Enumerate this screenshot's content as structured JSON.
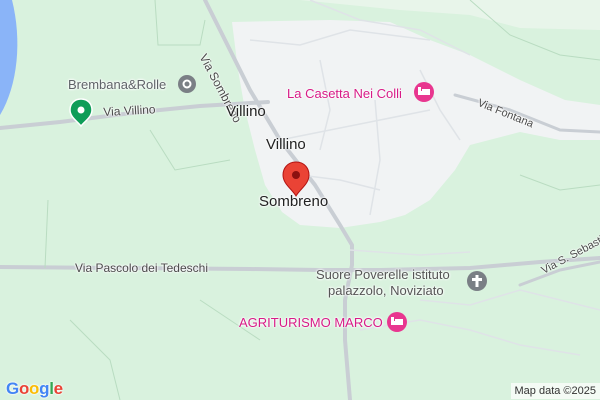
{
  "map": {
    "places": {
      "villino_top": "Villino",
      "villino_mid": "Villino",
      "sombreno": "Sombreno"
    },
    "roads": {
      "via_sombreno": "Via Sombreno",
      "via_villino": "Via Villino",
      "via_fontana": "Via Fontana",
      "via_pascolo": "Via Pascolo dei Tedeschi",
      "via_s_sebastiano": "Via S. Sebastiano"
    },
    "pois": {
      "brembana": "Brembana&Rolle",
      "casetta": "La Casetta Nei Colli",
      "suore_line1": "Suore Poverelle istituto",
      "suore_line2": "palazzolo, Noviziato",
      "agriturismo": "AGRITURISMO MARCO"
    },
    "icons": {
      "brembana": "gray-pin-icon",
      "brembana_marker": "green-map-marker-icon",
      "casetta": "hotel-bed-icon",
      "agriturismo": "hotel-bed-icon",
      "suore": "church-cross-icon",
      "selected": "red-location-pin-icon"
    },
    "colors": {
      "land": "#d9f2de",
      "urban": "#f1f3f4",
      "road": "#c9ced4",
      "water": "#8ab4f8",
      "pin_red": "#ea4335",
      "hotel_pink": "#e8368f",
      "poi_gray": "#7a7f85",
      "poi_green": "#0f9d58"
    }
  },
  "logo": "Google",
  "attribution": "Map data ©2025"
}
